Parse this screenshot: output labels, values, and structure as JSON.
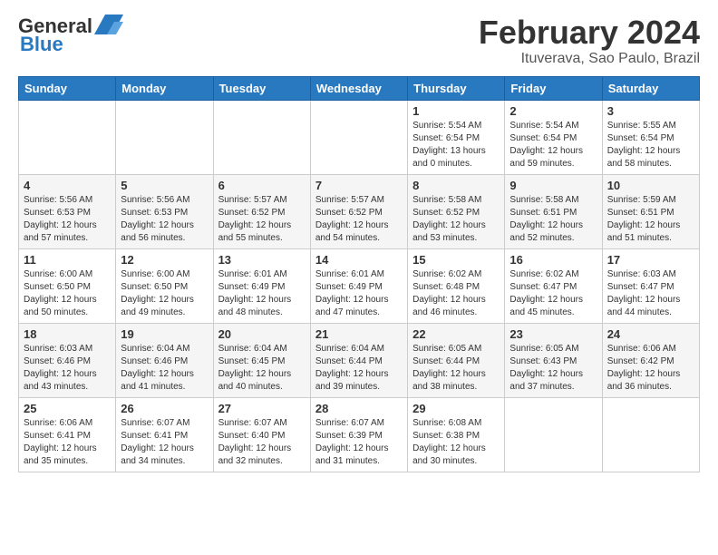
{
  "header": {
    "logo_line1": "General",
    "logo_line2": "Blue",
    "month": "February 2024",
    "location": "Ituverava, Sao Paulo, Brazil"
  },
  "weekdays": [
    "Sunday",
    "Monday",
    "Tuesday",
    "Wednesday",
    "Thursday",
    "Friday",
    "Saturday"
  ],
  "weeks": [
    [
      {
        "day": "",
        "info": ""
      },
      {
        "day": "",
        "info": ""
      },
      {
        "day": "",
        "info": ""
      },
      {
        "day": "",
        "info": ""
      },
      {
        "day": "1",
        "info": "Sunrise: 5:54 AM\nSunset: 6:54 PM\nDaylight: 13 hours\nand 0 minutes."
      },
      {
        "day": "2",
        "info": "Sunrise: 5:54 AM\nSunset: 6:54 PM\nDaylight: 12 hours\nand 59 minutes."
      },
      {
        "day": "3",
        "info": "Sunrise: 5:55 AM\nSunset: 6:54 PM\nDaylight: 12 hours\nand 58 minutes."
      }
    ],
    [
      {
        "day": "4",
        "info": "Sunrise: 5:56 AM\nSunset: 6:53 PM\nDaylight: 12 hours\nand 57 minutes."
      },
      {
        "day": "5",
        "info": "Sunrise: 5:56 AM\nSunset: 6:53 PM\nDaylight: 12 hours\nand 56 minutes."
      },
      {
        "day": "6",
        "info": "Sunrise: 5:57 AM\nSunset: 6:52 PM\nDaylight: 12 hours\nand 55 minutes."
      },
      {
        "day": "7",
        "info": "Sunrise: 5:57 AM\nSunset: 6:52 PM\nDaylight: 12 hours\nand 54 minutes."
      },
      {
        "day": "8",
        "info": "Sunrise: 5:58 AM\nSunset: 6:52 PM\nDaylight: 12 hours\nand 53 minutes."
      },
      {
        "day": "9",
        "info": "Sunrise: 5:58 AM\nSunset: 6:51 PM\nDaylight: 12 hours\nand 52 minutes."
      },
      {
        "day": "10",
        "info": "Sunrise: 5:59 AM\nSunset: 6:51 PM\nDaylight: 12 hours\nand 51 minutes."
      }
    ],
    [
      {
        "day": "11",
        "info": "Sunrise: 6:00 AM\nSunset: 6:50 PM\nDaylight: 12 hours\nand 50 minutes."
      },
      {
        "day": "12",
        "info": "Sunrise: 6:00 AM\nSunset: 6:50 PM\nDaylight: 12 hours\nand 49 minutes."
      },
      {
        "day": "13",
        "info": "Sunrise: 6:01 AM\nSunset: 6:49 PM\nDaylight: 12 hours\nand 48 minutes."
      },
      {
        "day": "14",
        "info": "Sunrise: 6:01 AM\nSunset: 6:49 PM\nDaylight: 12 hours\nand 47 minutes."
      },
      {
        "day": "15",
        "info": "Sunrise: 6:02 AM\nSunset: 6:48 PM\nDaylight: 12 hours\nand 46 minutes."
      },
      {
        "day": "16",
        "info": "Sunrise: 6:02 AM\nSunset: 6:47 PM\nDaylight: 12 hours\nand 45 minutes."
      },
      {
        "day": "17",
        "info": "Sunrise: 6:03 AM\nSunset: 6:47 PM\nDaylight: 12 hours\nand 44 minutes."
      }
    ],
    [
      {
        "day": "18",
        "info": "Sunrise: 6:03 AM\nSunset: 6:46 PM\nDaylight: 12 hours\nand 43 minutes."
      },
      {
        "day": "19",
        "info": "Sunrise: 6:04 AM\nSunset: 6:46 PM\nDaylight: 12 hours\nand 41 minutes."
      },
      {
        "day": "20",
        "info": "Sunrise: 6:04 AM\nSunset: 6:45 PM\nDaylight: 12 hours\nand 40 minutes."
      },
      {
        "day": "21",
        "info": "Sunrise: 6:04 AM\nSunset: 6:44 PM\nDaylight: 12 hours\nand 39 minutes."
      },
      {
        "day": "22",
        "info": "Sunrise: 6:05 AM\nSunset: 6:44 PM\nDaylight: 12 hours\nand 38 minutes."
      },
      {
        "day": "23",
        "info": "Sunrise: 6:05 AM\nSunset: 6:43 PM\nDaylight: 12 hours\nand 37 minutes."
      },
      {
        "day": "24",
        "info": "Sunrise: 6:06 AM\nSunset: 6:42 PM\nDaylight: 12 hours\nand 36 minutes."
      }
    ],
    [
      {
        "day": "25",
        "info": "Sunrise: 6:06 AM\nSunset: 6:41 PM\nDaylight: 12 hours\nand 35 minutes."
      },
      {
        "day": "26",
        "info": "Sunrise: 6:07 AM\nSunset: 6:41 PM\nDaylight: 12 hours\nand 34 minutes."
      },
      {
        "day": "27",
        "info": "Sunrise: 6:07 AM\nSunset: 6:40 PM\nDaylight: 12 hours\nand 32 minutes."
      },
      {
        "day": "28",
        "info": "Sunrise: 6:07 AM\nSunset: 6:39 PM\nDaylight: 12 hours\nand 31 minutes."
      },
      {
        "day": "29",
        "info": "Sunrise: 6:08 AM\nSunset: 6:38 PM\nDaylight: 12 hours\nand 30 minutes."
      },
      {
        "day": "",
        "info": ""
      },
      {
        "day": "",
        "info": ""
      }
    ]
  ]
}
